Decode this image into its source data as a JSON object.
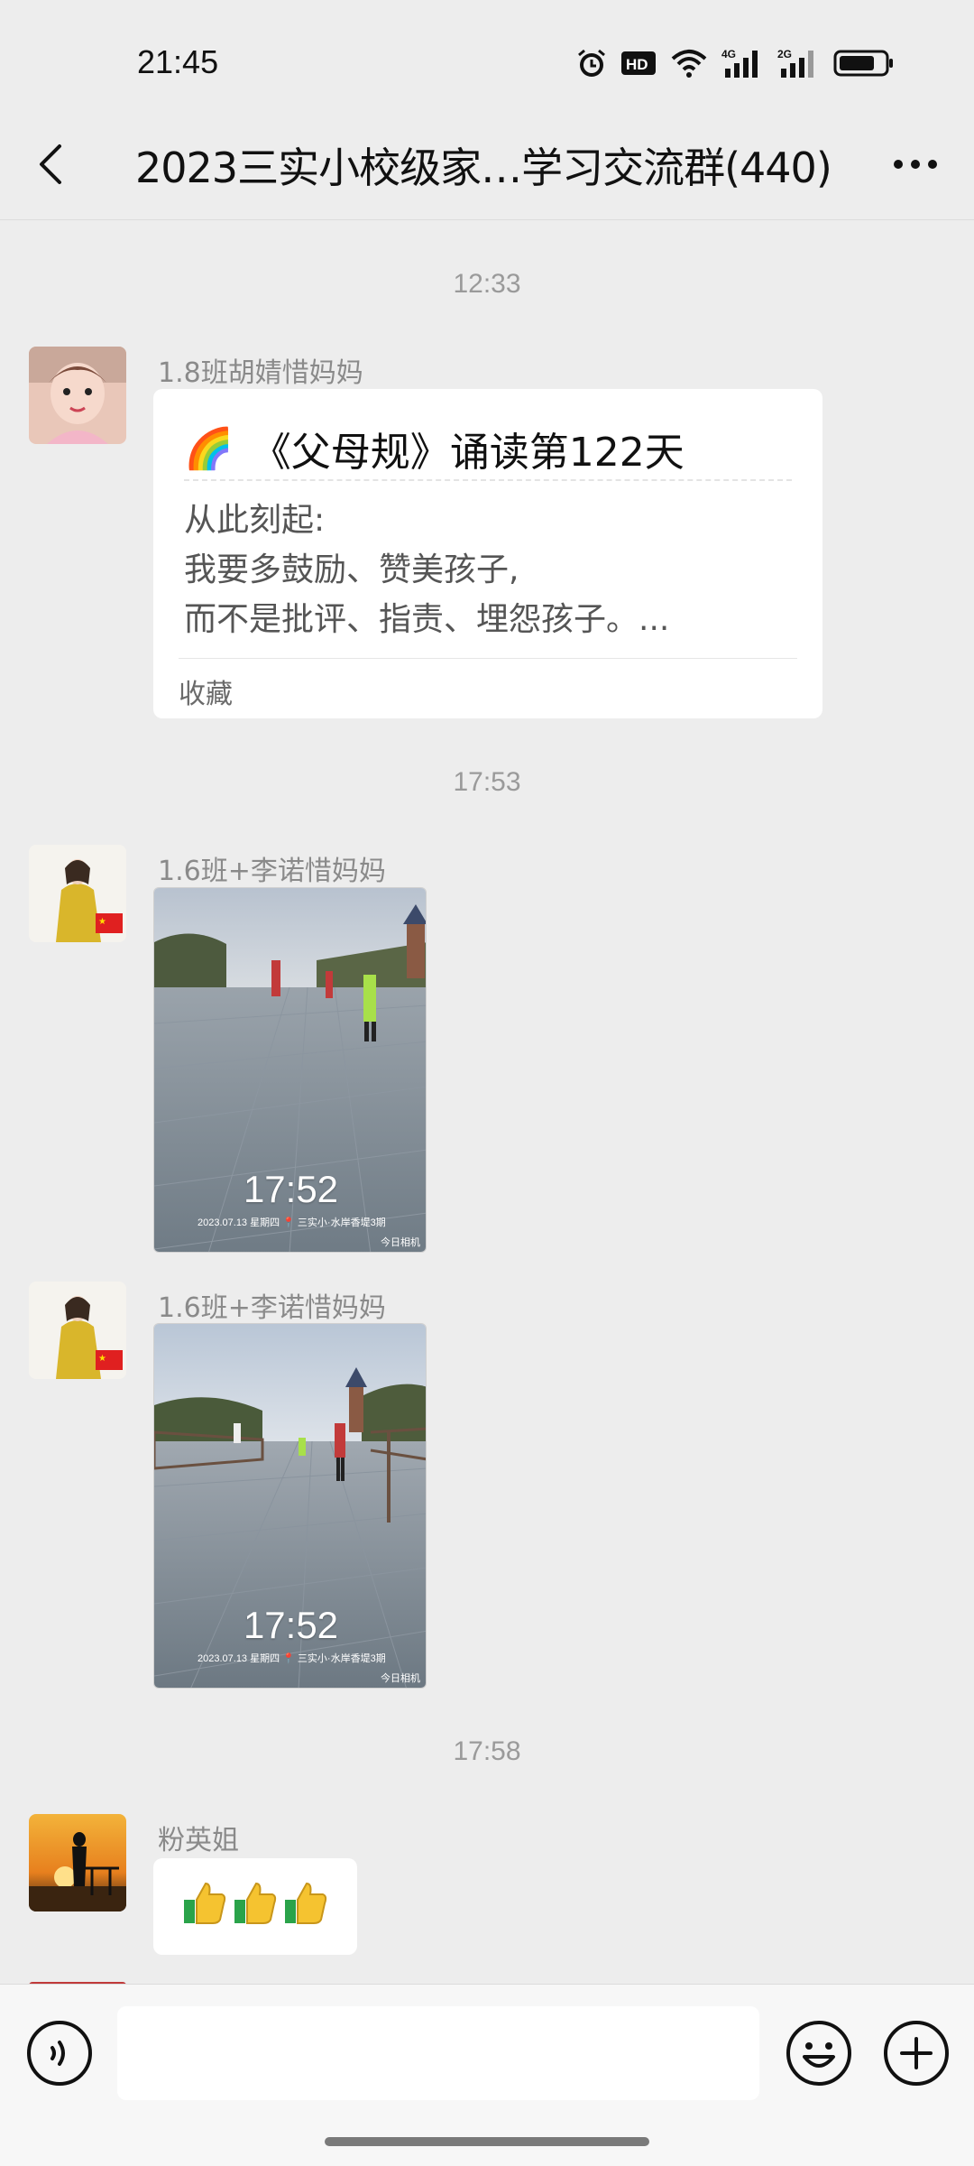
{
  "status_bar": {
    "time": "21:45",
    "icons": [
      "alarm-icon",
      "hd-icon",
      "wifi-icon",
      "signal-4g-icon",
      "signal-2g-icon",
      "battery-icon"
    ],
    "hd_label": "HD",
    "net1_label": "4G",
    "net2_label": "2G"
  },
  "header": {
    "title": "2023三实小校级家…学习交流群(440)"
  },
  "messages": [
    {
      "type": "time",
      "text": "12:33"
    },
    {
      "type": "card",
      "sender": "1.8班胡婧惜妈妈",
      "card_emoji": "🌈",
      "card_title": "《父母规》诵读第122天",
      "card_lines": [
        "从此刻起:",
        "我要多鼓励、赞美孩子,",
        "而不是批评、指责、埋怨孩子。..."
      ],
      "card_footer": "收藏"
    },
    {
      "type": "time",
      "text": "17:53"
    },
    {
      "type": "photo",
      "sender": "1.6班+李诺惜妈妈",
      "overlay_time": "17:52",
      "overlay_meta": "2023.07.13 星期四 📍 三实小·水岸香堤3期",
      "overlay_brand": "今日相机"
    },
    {
      "type": "photo",
      "sender": "1.6班+李诺惜妈妈",
      "overlay_time": "17:52",
      "overlay_meta": "2023.07.13 星期四 📍 三实小·水岸香堤3期",
      "overlay_brand": "今日相机"
    },
    {
      "type": "time",
      "text": "17:58"
    },
    {
      "type": "emoji",
      "sender": "粉英姐",
      "emoji_count": 3
    }
  ],
  "colors": {
    "background": "#ededed",
    "bubble": "#ffffff",
    "meta_text": "#9a9a9a"
  }
}
